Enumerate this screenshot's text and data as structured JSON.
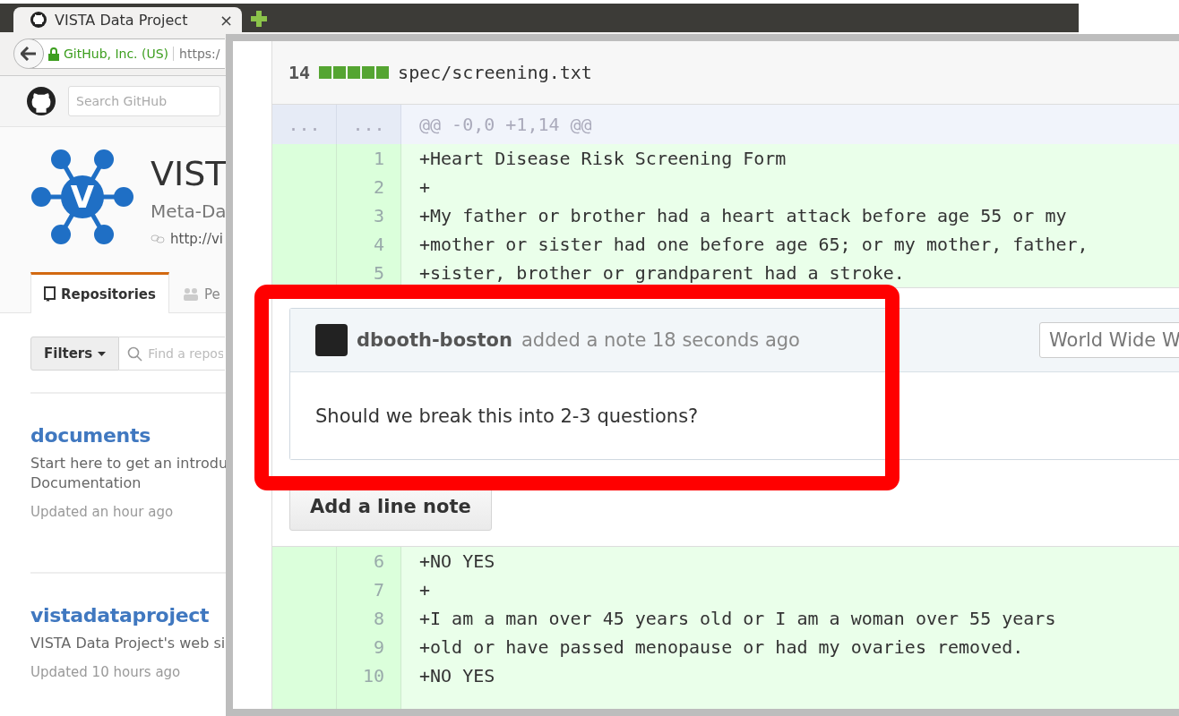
{
  "browser": {
    "tab": {
      "title": "VISTA Data Project",
      "close": "×"
    },
    "address_bar": {
      "identity": "GitHub, Inc. (US)",
      "url": "https:/"
    }
  },
  "github_header": {
    "search": {
      "placeholder": "Search GitHub"
    }
  },
  "org": {
    "logo_letter": "V",
    "name": "VIST",
    "description": "Meta-Da",
    "link": "http://vi"
  },
  "tabs": [
    {
      "label": "Repositories",
      "selected": true
    },
    {
      "label": "Pe",
      "selected": false
    }
  ],
  "filters": {
    "button": "Filters",
    "search": {
      "placeholder": "Find a repos"
    }
  },
  "repositories": [
    {
      "name": "documents",
      "description_lines": [
        "Start here to get an introdu",
        "Documentation"
      ],
      "updated": "Updated an hour ago"
    },
    {
      "name": "vistadataproject",
      "description_lines": [
        "VISTA Data Project's web si"
      ],
      "updated": "Updated 10 hours ago"
    }
  ],
  "diff": {
    "file": {
      "additions": "14",
      "path": "spec/screening.txt"
    },
    "hunk": {
      "old": "...",
      "new": "...",
      "header": "@@ -0,0 +1,14 @@"
    },
    "lines_before": [
      {
        "number": "1",
        "text": "+Heart Disease Risk Screening Form"
      },
      {
        "number": "2",
        "text": "+"
      },
      {
        "number": "3",
        "text": "+My father or brother had a heart attack before age 55 or my"
      },
      {
        "number": "4",
        "text": "+mother or sister had one before age 65; or my mother, father,"
      },
      {
        "number": "5",
        "text": "+sister, brother or grandparent had a stroke."
      }
    ],
    "note": {
      "author": "dbooth-boston",
      "action": "added a note 18 seconds ago",
      "select": "World Wide W",
      "body": "Should we break this into 2-3 questions?"
    },
    "add_note_button": "Add a line note",
    "lines_after": [
      {
        "number": "6",
        "text": "+NO YES"
      },
      {
        "number": "7",
        "text": "+"
      },
      {
        "number": "8",
        "text": "+I am a man over 45 years old or I am a woman over 55 years"
      },
      {
        "number": "9",
        "text": "+old or have passed menopause or had my ovaries removed."
      },
      {
        "number": "10",
        "text": "+NO YES"
      }
    ]
  }
}
